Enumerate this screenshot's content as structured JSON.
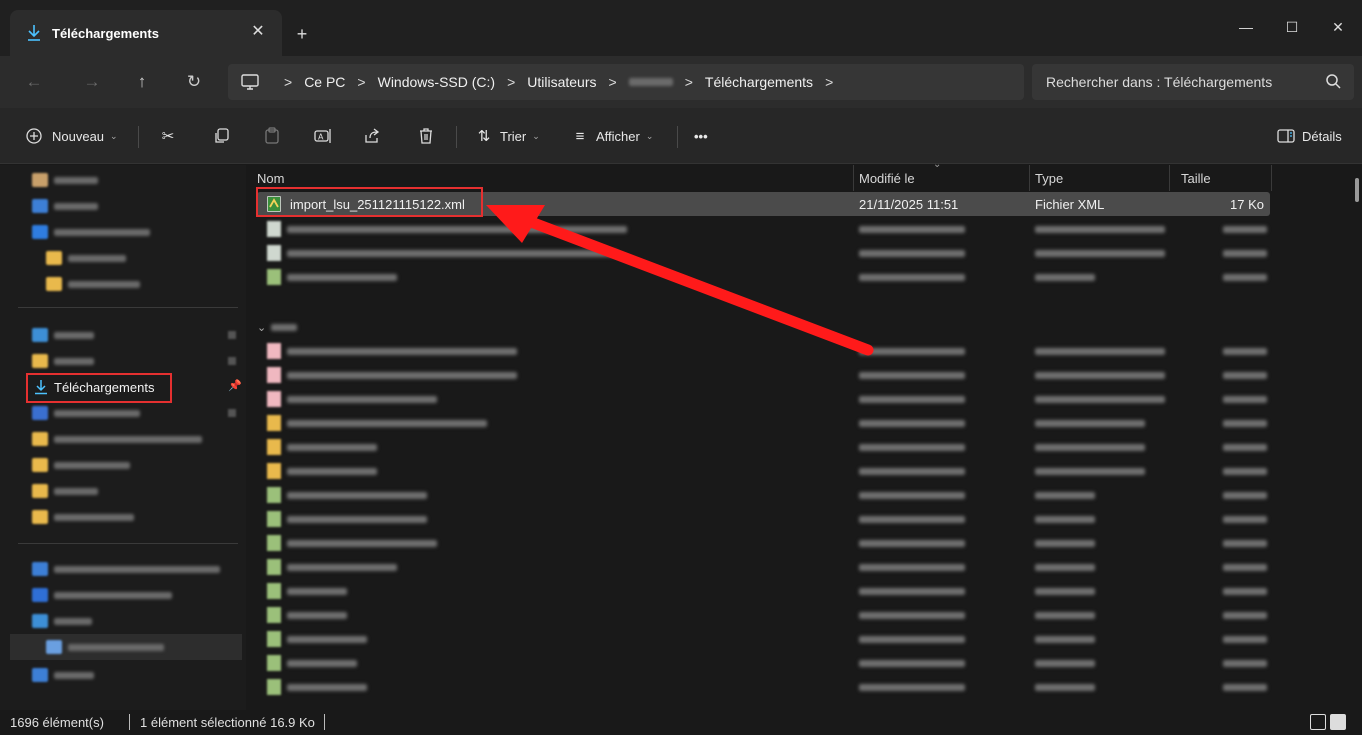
{
  "window": {
    "tab_title": "Téléchargements",
    "tab_close": "✕",
    "new_tab": "+",
    "minimize": "—",
    "maximize": "☐",
    "close": "✕"
  },
  "nav": {
    "back": "←",
    "forward": "→",
    "up": "↑",
    "refresh": "↻"
  },
  "breadcrumb": {
    "items": [
      "Ce PC",
      "Windows-SSD (C:)",
      "Utilisateurs",
      "",
      "Téléchargements"
    ],
    "sep": ">"
  },
  "search": {
    "placeholder": "Rechercher dans : Téléchargements"
  },
  "toolbar": {
    "new_label": "Nouveau",
    "sort_label": "Trier",
    "view_label": "Afficher",
    "more": "•••",
    "details_label": "Détails"
  },
  "sidebar": {
    "downloads_label": "Téléchargements"
  },
  "columns": {
    "name": "Nom",
    "modified": "Modifié le",
    "type": "Type",
    "size": "Taille"
  },
  "selected_file": {
    "name": "import_lsu_251121115122.xml",
    "modified": "21/11/2025 11:51",
    "type": "Fichier XML",
    "size": "17 Ko"
  },
  "status": {
    "count": "1696 élément(s)",
    "selection": "1 élément sélectionné  16.9 Ko"
  },
  "colors": {
    "highlight": "#e53030",
    "accent": "#4cc2ff",
    "folder": "#e9b94c"
  }
}
